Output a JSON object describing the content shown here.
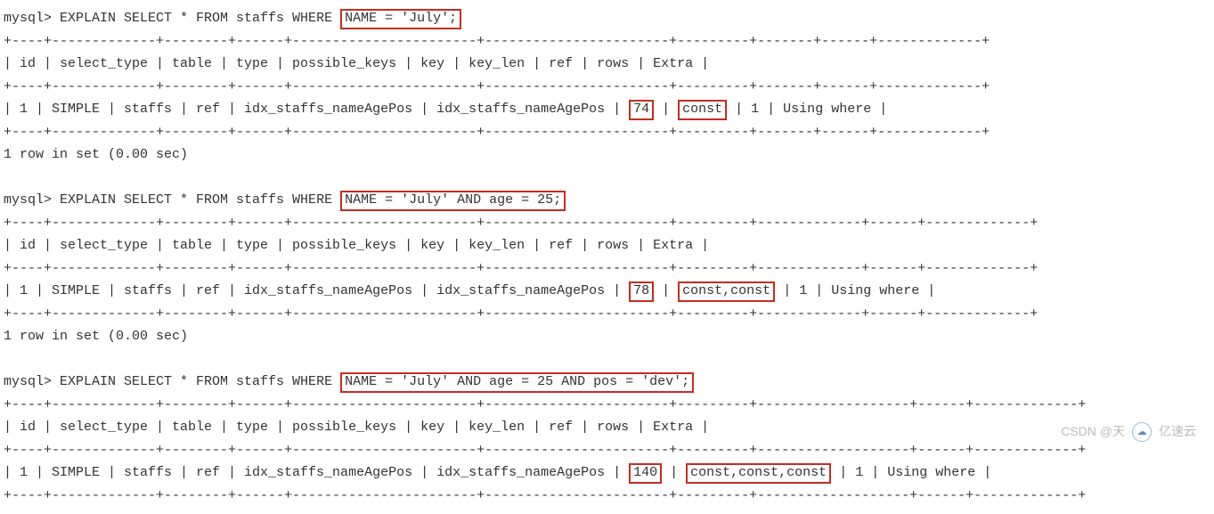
{
  "queries": [
    {
      "prompt": "mysql> ",
      "sql_before": "EXPLAIN SELECT * FROM staffs WHERE ",
      "sql_highlight": "NAME = 'July';",
      "sql_after": "",
      "table": {
        "border_top": "+----+-------------+--------+------+-----------------------+-----------------------+---------+-------+------+-------------+",
        "header": "| id | select_type | table  | type | possible_keys         | key                   | key_len | ref   | rows | Extra       |",
        "border_mid": "+----+-------------+--------+------+-----------------------+-----------------------+---------+-------+------+-------------+",
        "row_before": "|  1 | SIMPLE      | staffs | ref  | idx_staffs_nameAgePos | idx_staffs_nameAgePos | ",
        "row_hl1": "74",
        "row_between": "      | ",
        "row_hl2": "const",
        "row_after": " |    1 | Using where |",
        "border_bot": "+----+-------------+--------+------+-----------------------+-----------------------+---------+-------+------+-------------+"
      },
      "footer": "1 row in set (0.00 sec)"
    },
    {
      "prompt": "mysql> ",
      "sql_before": "EXPLAIN SELECT * FROM staffs WHERE ",
      "sql_highlight": "NAME = 'July' AND age = 25;",
      "sql_after": "",
      "table": {
        "border_top": "+----+-------------+--------+------+-----------------------+-----------------------+---------+-------------+------+-------------+",
        "header": "| id | select_type | table  | type | possible_keys         | key                   | key_len | ref         | rows | Extra       |",
        "border_mid": "+----+-------------+--------+------+-----------------------+-----------------------+---------+-------------+------+-------------+",
        "row_before": "|  1 | SIMPLE      | staffs | ref  | idx_staffs_nameAgePos | idx_staffs_nameAgePos | ",
        "row_hl1": "78",
        "row_between": "      | ",
        "row_hl2": "const,const",
        "row_after": " |    1 | Using where |",
        "border_bot": "+----+-------------+--------+------+-----------------------+-----------------------+---------+-------------+------+-------------+"
      },
      "footer": "1 row in set (0.00 sec)"
    },
    {
      "prompt": "mysql> ",
      "sql_before": "EXPLAIN SELECT * FROM staffs WHERE ",
      "sql_highlight": "NAME = 'July' AND age = 25 AND pos = 'dev';",
      "sql_after": "",
      "table": {
        "border_top": "+----+-------------+--------+------+-----------------------+-----------------------+---------+-------------------+------+-------------+",
        "header": "| id | select_type | table  | type | possible_keys         | key                   | key_len | ref               | rows | Extra       |",
        "border_mid": "+----+-------------+--------+------+-----------------------+-----------------------+---------+-------------------+------+-------------+",
        "row_before": "|  1 | SIMPLE      | staffs | ref  | idx_staffs_nameAgePos | idx_staffs_nameAgePos | ",
        "row_hl1": "140",
        "row_between": "     | ",
        "row_hl2": "const,const,const",
        "row_after": " |    1 | Using where |",
        "border_bot": "+----+-------------+--------+------+-----------------------+-----------------------+---------+-------------------+------+-------------+"
      },
      "footer": ""
    }
  ],
  "watermark": {
    "text1": "CSDN @天",
    "text2": "亿速云"
  }
}
